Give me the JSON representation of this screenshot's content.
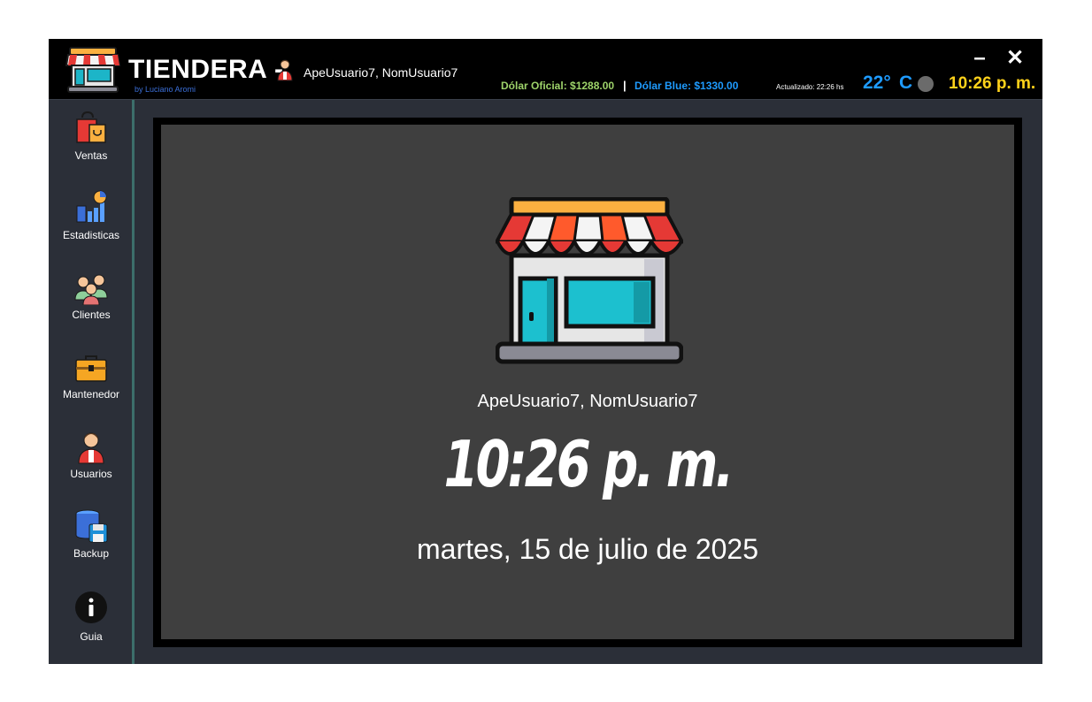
{
  "app": {
    "title": "TIENDERA -",
    "byline": "by Luciano Aromi",
    "user": "ApeUsuario7, NomUsuario7"
  },
  "header": {
    "dolar_oficial": "Dólar Oficial: $1288.00",
    "separator": "|",
    "dolar_blue": "Dólar Blue: $1330.00",
    "updated": "Actualizado: 22:26 hs",
    "temperature": "22°",
    "temperature_unit": "C",
    "clock": "10:26 p. m.",
    "minimize": "–",
    "close": "✕"
  },
  "sidebar": {
    "items": [
      {
        "label": "Ventas",
        "icon": "shopping-bags-icon"
      },
      {
        "label": "Estadisticas",
        "icon": "statistics-icon"
      },
      {
        "label": "Clientes",
        "icon": "clients-icon"
      },
      {
        "label": "Mantenedor",
        "icon": "toolbox-icon"
      },
      {
        "label": "Usuarios",
        "icon": "user-icon"
      },
      {
        "label": "Backup",
        "icon": "database-save-icon"
      },
      {
        "label": "Guia",
        "icon": "info-icon"
      }
    ]
  },
  "main": {
    "user": "ApeUsuario7, NomUsuario7",
    "clock": "10:26 p. m.",
    "date": "martes, 15 de julio de 2025"
  },
  "colors": {
    "topbar": "#000000",
    "sidebar": "#2b2f38",
    "panel": "#3f3f3f",
    "oficial": "#9ed36a",
    "blue": "#1e9bff",
    "clock": "#ffd21a"
  }
}
